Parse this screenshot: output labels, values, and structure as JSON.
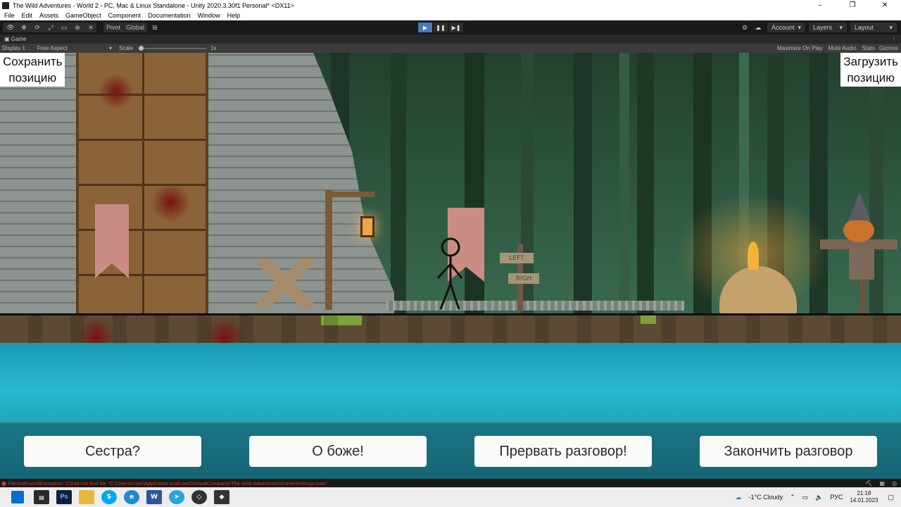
{
  "window": {
    "title": "The Wild Adventures - World 2 - PC, Mac & Linux Standalone - Unity 2020.3.30f1 Personal* <DX11>",
    "controls": [
      "–",
      "❐",
      "✕"
    ]
  },
  "menu": [
    "File",
    "Edit",
    "Assets",
    "GameObject",
    "Component",
    "Documentation",
    "Window",
    "Help"
  ],
  "toolbar": {
    "pivot_label": "Pivot",
    "global_label": "Global",
    "account_label": "Account",
    "layers_label": "Layers",
    "layout_label": "Layout"
  },
  "game_view": {
    "tab_label": "Game",
    "display_label": "Display 1",
    "aspect_label": "Free Aspect",
    "scale_label": "Scale",
    "scale_value": "1x",
    "maximize_label": "Maximize On Play",
    "mute_label": "Mute Audio",
    "stats_label": "Stats",
    "gizmos_label": "Gizmos"
  },
  "game": {
    "save_button": "Сохранить\nпозицию",
    "load_button": "Загрузить\nпозицию",
    "sign_left": "LEFT",
    "sign_right": "RIGH",
    "choices": [
      "Сестра?",
      "О боже!",
      "Прервать разговор!",
      "Закончить разговор"
    ]
  },
  "console": {
    "error": "FileNotFoundException: Could not find file \"C:\\Users\\User\\AppData\\LocalLow\\DefaultCompany\\The Wild Adventures\\GameSettings.json\""
  },
  "taskbar": {
    "weather": "-1°C  Cloudy",
    "language": "РУС",
    "time": "21:18",
    "date": "14.01.2023"
  },
  "colors": {
    "accent_play": "#4a78c0",
    "error_text": "#d43a2a",
    "water": "#27b9cf"
  }
}
